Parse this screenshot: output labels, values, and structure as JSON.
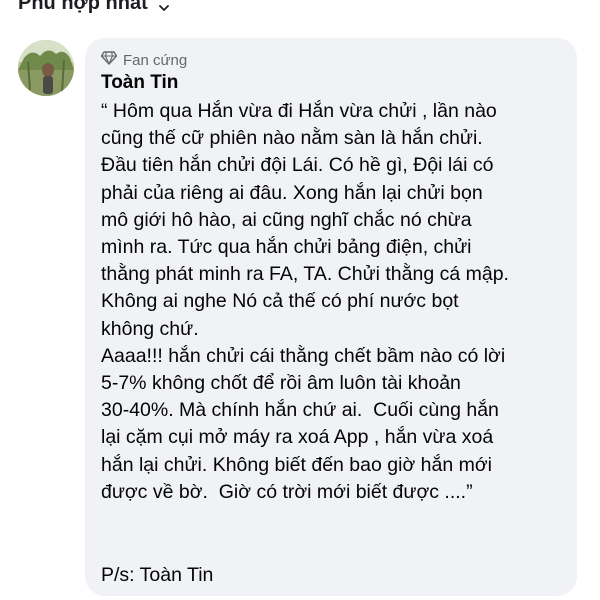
{
  "header": {
    "sort_label": "Phù hợp nhất",
    "chevron_icon": "chevron-down-icon"
  },
  "comment": {
    "badge_icon": "diamond-icon",
    "badge_label": "Fan cứng",
    "author": "Toàn Tin",
    "text": "“ Hôm qua Hắn vừa đi Hắn vừa chửi , lần nào\ncũng thế cữ phiên nào nằm sàn là hắn chửi.\nĐầu tiên hắn chửi đội Lái. Có hề gì, Đội lái có\nphải của riêng ai đâu. Xong hắn lại chửi bọn\nmô giới hô hào, ai cũng nghĩ chắc nó chừa\nmình ra. Tức qua hắn chửi bảng điện, chửi\nthằng phát minh ra FA, TA. Chửi thằng cá mập.\nKhông ai nghe Nó cả thế có phí nước bọt\nkhông chứ.\nAaaa!!! hắn chửi cái thằng chết bầm nào có lời\n5-7% không chốt để rồi âm luôn tài khoản\n30-40%. Mà chính hắn chứ ai.  Cuối cùng hắn\nlại cặm cụi mở máy ra xoá App , hắn vừa xoá\nhắn lại chửi. Không biết đến bao giờ hắn mới\nđược về bờ.  Giờ có trời mới biết được ....”",
    "signature": "P/s: Toàn Tin"
  },
  "colors": {
    "bubble_bg": "#f0f2f5",
    "badge_text": "#65676b",
    "text": "#050505"
  }
}
